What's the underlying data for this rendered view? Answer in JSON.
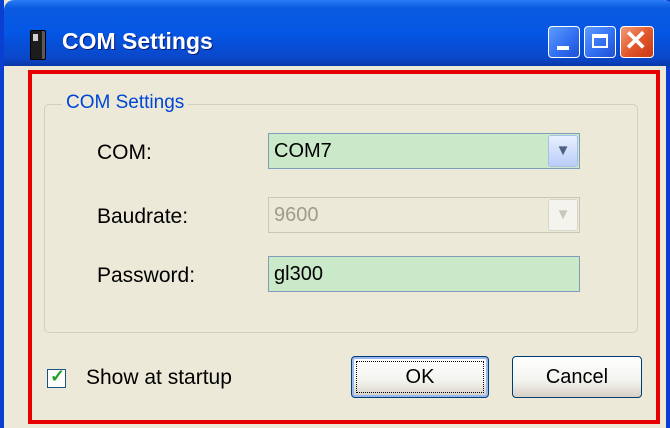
{
  "window": {
    "title": "COM Settings"
  },
  "titlebar_buttons": {
    "minimize": "minimize",
    "maximize": "maximize",
    "close": "close"
  },
  "group": {
    "legend": "COM Settings",
    "com": {
      "label": "COM:",
      "value": "COM7"
    },
    "baudrate": {
      "label": "Baudrate:",
      "value": "9600",
      "disabled": true
    },
    "password": {
      "label": "Password:",
      "value": "gl300"
    }
  },
  "show_at_startup": {
    "label": "Show at startup",
    "checked": true
  },
  "buttons": {
    "ok": "OK",
    "cancel": "Cancel"
  },
  "colors": {
    "titlebar": "#0456e4",
    "field_bg": "#c9e9c9",
    "highlight": "#e60000",
    "legend": "#0046d5"
  }
}
